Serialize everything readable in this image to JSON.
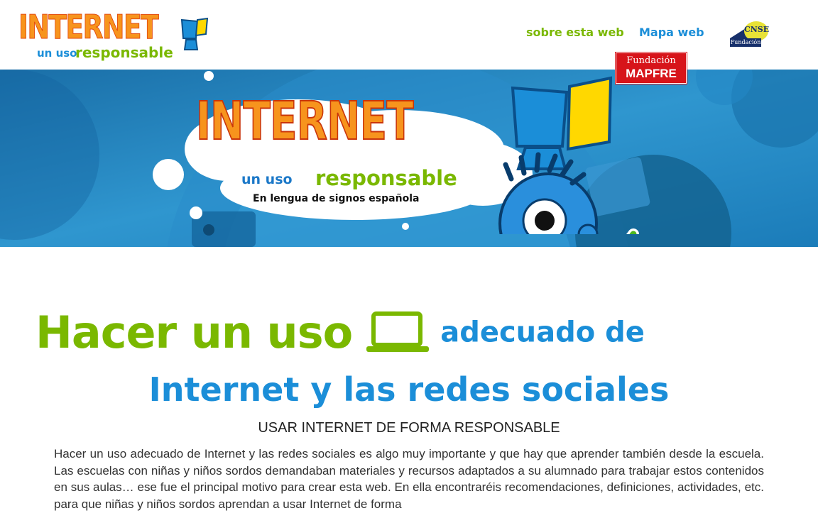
{
  "header": {
    "logo": {
      "title": "INTERNET",
      "subtitle_prefix": "un uso",
      "subtitle_main": "responsable"
    },
    "nav": {
      "about_label": "sobre esta web",
      "sitemap_label": "Mapa web"
    },
    "partners": {
      "cnse_label": "CNSE",
      "cnse_sub": "Fundación",
      "mapfre_top": "Fundación",
      "mapfre_bottom": "MAPFRE"
    }
  },
  "banner": {
    "title": "INTERNET",
    "subtitle_prefix": "un uso",
    "subtitle_main": "responsable",
    "tagline": "En lengua de signos española"
  },
  "main": {
    "headline_part1": "Hacer un uso",
    "headline_part2": "adecuado de",
    "headline_line2": "Internet y las redes sociales",
    "section_heading": "USAR INTERNET DE FORMA RESPONSABLE",
    "intro": "Hacer un uso adecuado de Internet y las redes sociales es algo muy importante y que hay que aprender también desde la escuela. Las escuelas con niñas y niños sordos demandaban materiales y recursos adaptados a su alumnado para trabajar estos contenidos en sus aulas… ese fue el principal motivo para crear esta web. En ella encontraréis recomendaciones, definiciones, actividades, etc. para que niñas y niños sordos aprendan a usar Internet de forma"
  },
  "colors": {
    "green": "#7ab800",
    "blue": "#1b8ed8",
    "orange": "#f7941d",
    "banner_blue": "#1f7fb8",
    "mapfre_red": "#d7141a"
  },
  "icons": {
    "logo_monitor": "monitor-icon",
    "laptop": "laptop-icon",
    "check": "checkmark-icon",
    "mascot": "mascot-icon"
  }
}
